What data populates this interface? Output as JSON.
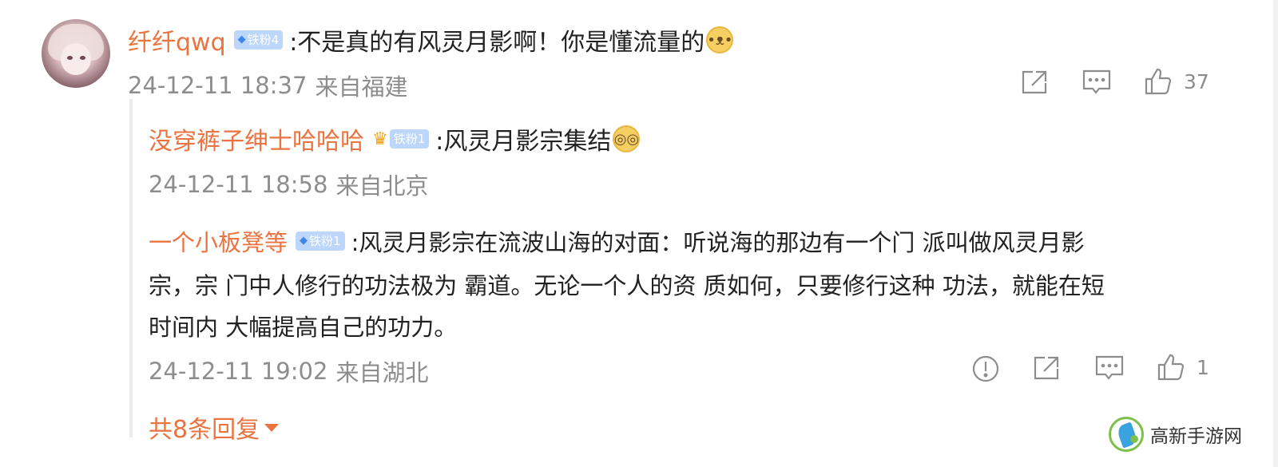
{
  "comment": {
    "username": "纤纤qwq",
    "badge_label": "铁粉",
    "badge_level": "4",
    "text": ":不是真的有风灵月影啊！你是懂流量的",
    "emoji_icon": "doge-emoji",
    "timestamp": "24-12-11 18:37",
    "location": "来自福建",
    "like_count": "37"
  },
  "replies": [
    {
      "username": "没穿裤子绅士哈哈哈",
      "badge_label": "铁粉",
      "badge_level": "1",
      "text": ":风灵月影宗集结",
      "emoji_icon": "glasses-emoji",
      "timestamp": "24-12-11 18:58",
      "location": "来自北京"
    },
    {
      "username": "一个小板凳等",
      "badge_label": "铁粉",
      "badge_level": "1",
      "text_line1": ":风灵月影宗在流波山海的对面：听说海的那边有一个门 派叫做风灵月影",
      "text_line2": "宗，宗 门中人修行的功法极为 霸道。无论一个人的资 质如何，只要修行这种 功法，就能在短",
      "text_line3": "时间内 大幅提高自己的功力。",
      "timestamp": "24-12-11 19:02",
      "location": "来自湖北",
      "like_count": "1"
    }
  ],
  "more_replies_label": "共8条回复",
  "watermark_text": "高新手游网",
  "colors": {
    "username": "#eb7340",
    "meta": "#8d8d8d",
    "badge_bg": "#bcd7fb"
  }
}
